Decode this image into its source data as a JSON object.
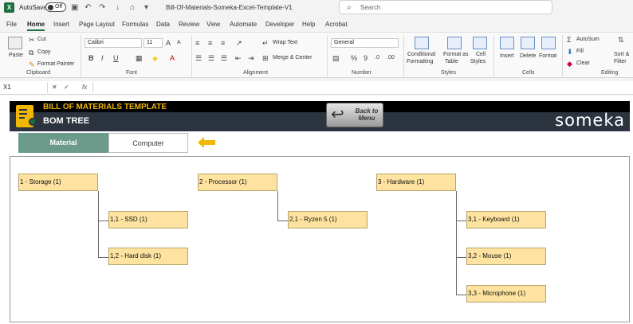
{
  "titlebar": {
    "autosave_label": "AutoSave",
    "autosave_state": "Off",
    "doc_title": "Bill-Of-Materials-Someka-Excel-Template-V1",
    "search_placeholder": "Search"
  },
  "ribbon_tabs": [
    "File",
    "Home",
    "Insert",
    "Page Layout",
    "Formulas",
    "Data",
    "Review",
    "View",
    "Automate",
    "Developer",
    "Help",
    "Acrobat"
  ],
  "active_tab": "Home",
  "ribbon": {
    "clipboard": {
      "paste": "Paste",
      "cut": "Cut",
      "copy": "Copy",
      "format_painter": "Format Painter",
      "label": "Clipboard"
    },
    "font": {
      "name": "Calibri",
      "size": "11",
      "label": "Font"
    },
    "alignment": {
      "wrap": "Wrap Text",
      "merge": "Merge & Center",
      "label": "Alignment"
    },
    "number": {
      "format": "General",
      "label": "Number"
    },
    "styles": {
      "cond": [
        "Conditional",
        "Formatting"
      ],
      "table": [
        "Format as",
        "Table"
      ],
      "cell": [
        "Cell",
        "Styles"
      ],
      "label": "Styles"
    },
    "cells": {
      "insert": "Insert",
      "delete": "Delete",
      "format": "Format",
      "label": "Cells"
    },
    "editing": {
      "autosum": "AutoSum",
      "fill": "Fill",
      "clear": "Clear",
      "sort": [
        "Sort &",
        "Filter"
      ],
      "label": "Editing"
    }
  },
  "formula_bar": {
    "cell_ref": "X1",
    "fx": "fx",
    "value": ""
  },
  "sheet": {
    "banner_title": "BILL OF MATERIALS TEMPLATE",
    "banner_subtitle": "BOM TREE",
    "back_button": "Back to Menu",
    "brand": "someka",
    "tabs": {
      "material": "Material",
      "computer": "Computer"
    }
  },
  "tree": {
    "nodes": [
      {
        "id": "n1",
        "label": "1 - Storage (1)"
      },
      {
        "id": "n11",
        "label": "1,1 - SSD (1)"
      },
      {
        "id": "n12",
        "label": "1,2 - Hard disk (1)"
      },
      {
        "id": "n2",
        "label": "2 - Processor (1)"
      },
      {
        "id": "n21",
        "label": "2,1 - Ryzen 5 (1)"
      },
      {
        "id": "n3",
        "label": "3 - Hardware (1)"
      },
      {
        "id": "n31",
        "label": "3,1 - Keyboard (1)"
      },
      {
        "id": "n32",
        "label": "3,2 - Mouse (1)"
      },
      {
        "id": "n33",
        "label": "3,3 - Microphone (1)"
      }
    ]
  },
  "colors": {
    "excel_green": "#1d6f42",
    "banner_dark": "#2c3440",
    "banner_accent": "#f2b705",
    "node_fill": "#fde39f",
    "material_tab": "#6c9b8c"
  }
}
